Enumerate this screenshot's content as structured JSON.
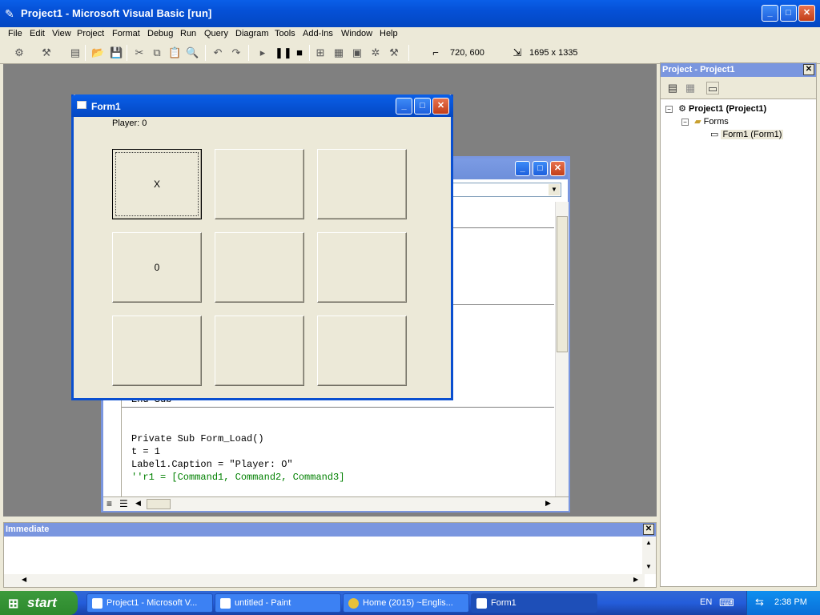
{
  "window": {
    "title": "Project1 - Microsoft Visual Basic [run]"
  },
  "menu": [
    "File",
    "Edit",
    "View",
    "Project",
    "Format",
    "Debug",
    "Run",
    "Query",
    "Diagram",
    "Tools",
    "Add-Ins",
    "Window",
    "Help"
  ],
  "toolbar": {
    "position": "720, 600",
    "size": "1695 x 1335"
  },
  "form1": {
    "title": "Form1",
    "label": "Player: 0",
    "cells": [
      "X",
      "",
      "",
      "0",
      "",
      "",
      "",
      "",
      ""
    ]
  },
  "code": {
    "end_sub": "End Sub",
    "lines": [
      "Private Sub Form_Load()",
      "t = 1",
      "Label1.Caption = \"Player: O\"",
      "''r1 = [Command1, Command2, Command3]"
    ]
  },
  "project": {
    "title": "Project - Project1",
    "root": "Project1 (Project1)",
    "folder": "Forms",
    "form": "Form1 (Form1)"
  },
  "immediate": {
    "title": "Immediate"
  },
  "taskbar": {
    "start": "start",
    "tasks": [
      "Project1 - Microsoft V...",
      "untitled - Paint",
      "Home (2015) ~Englis...",
      "Form1"
    ],
    "lang": "EN",
    "clock": "2:38 PM"
  },
  "colors": {
    "xp_blue": "#0A5FE8",
    "panel_blue": "#7A96DF",
    "comment_green": "#008000",
    "start_green": "#3C9A3C"
  }
}
